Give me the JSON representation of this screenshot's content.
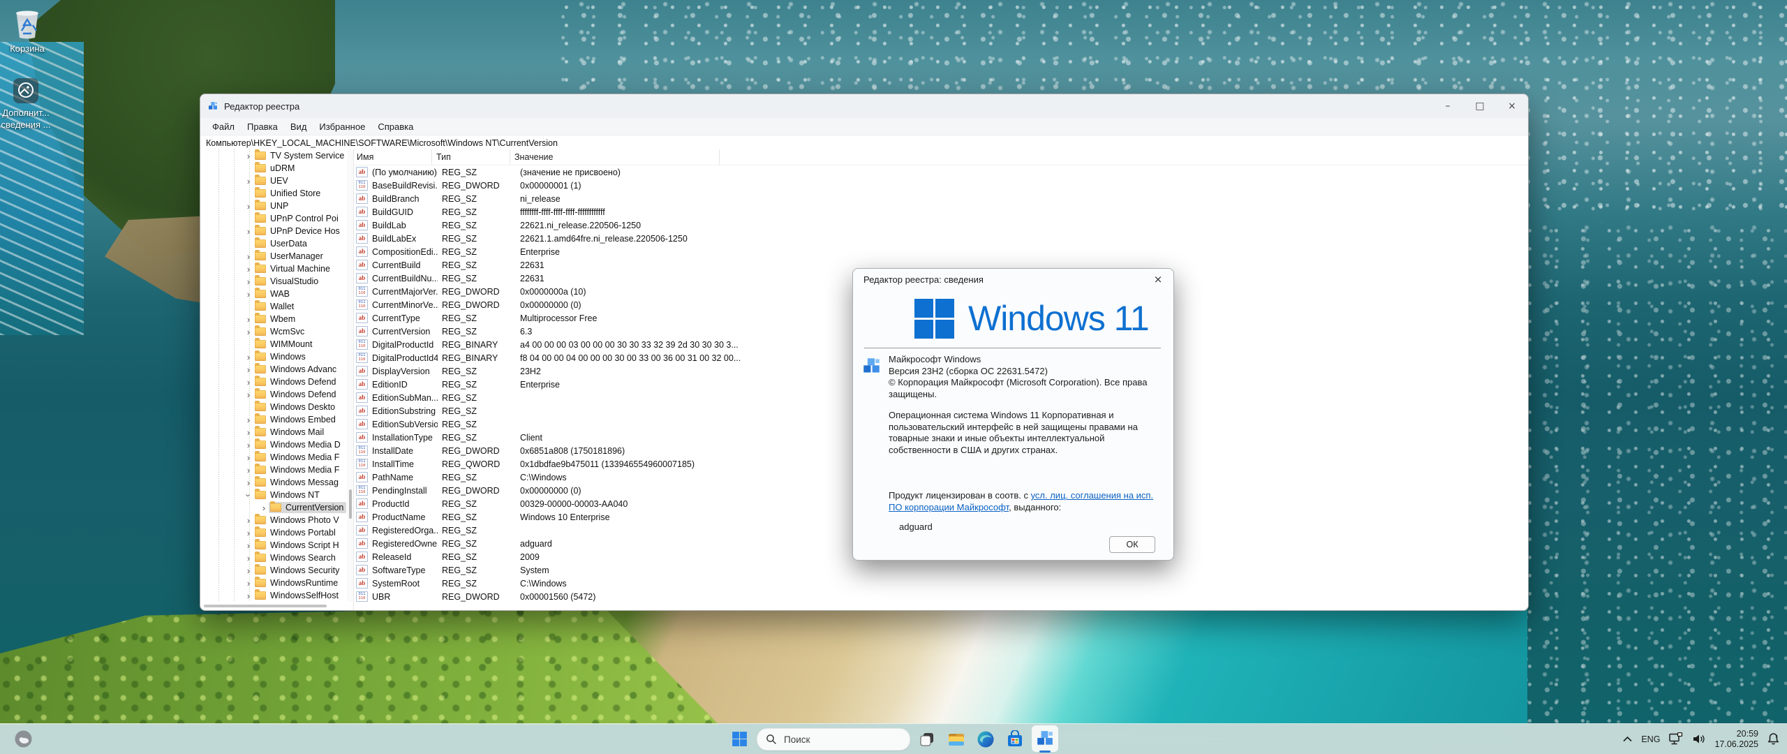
{
  "desktop": {
    "icons": [
      {
        "label": "Корзина"
      },
      {
        "label_line1": "Дополнит...",
        "label_line2": "сведения ..."
      }
    ]
  },
  "registry_window": {
    "title": "Редактор реестра",
    "window_controls": {
      "minimize": "–",
      "maximize": "□",
      "close": "×"
    },
    "menu": [
      "Файл",
      "Правка",
      "Вид",
      "Избранное",
      "Справка"
    ],
    "address": "Компьютер\\HKEY_LOCAL_MACHINE\\SOFTWARE\\Microsoft\\Windows NT\\CurrentVersion",
    "tree": {
      "items": [
        {
          "label": "TV System Service",
          "state": "collapsed",
          "depth": 0,
          "selected": false
        },
        {
          "label": "uDRM",
          "state": "leaf",
          "depth": 0,
          "selected": false
        },
        {
          "label": "UEV",
          "state": "collapsed",
          "depth": 0,
          "selected": false
        },
        {
          "label": "Unified Store",
          "state": "leaf",
          "depth": 0,
          "selected": false
        },
        {
          "label": "UNP",
          "state": "collapsed",
          "depth": 0,
          "selected": false
        },
        {
          "label": "UPnP Control Poi",
          "state": "leaf",
          "depth": 0,
          "selected": false
        },
        {
          "label": "UPnP Device Hos",
          "state": "collapsed",
          "depth": 0,
          "selected": false
        },
        {
          "label": "UserData",
          "state": "leaf",
          "depth": 0,
          "selected": false
        },
        {
          "label": "UserManager",
          "state": "collapsed",
          "depth": 0,
          "selected": false
        },
        {
          "label": "Virtual Machine",
          "state": "collapsed",
          "depth": 0,
          "selected": false
        },
        {
          "label": "VisualStudio",
          "state": "collapsed",
          "depth": 0,
          "selected": false
        },
        {
          "label": "WAB",
          "state": "collapsed",
          "depth": 0,
          "selected": false
        },
        {
          "label": "Wallet",
          "state": "leaf",
          "depth": 0,
          "selected": false
        },
        {
          "label": "Wbem",
          "state": "collapsed",
          "depth": 0,
          "selected": false
        },
        {
          "label": "WcmSvc",
          "state": "collapsed",
          "depth": 0,
          "selected": false
        },
        {
          "label": "WIMMount",
          "state": "leaf",
          "depth": 0,
          "selected": false
        },
        {
          "label": "Windows",
          "state": "collapsed",
          "depth": 0,
          "selected": false
        },
        {
          "label": "Windows Advanc",
          "state": "collapsed",
          "depth": 0,
          "selected": false
        },
        {
          "label": "Windows Defend",
          "state": "collapsed",
          "depth": 0,
          "selected": false
        },
        {
          "label": "Windows Defend",
          "state": "collapsed",
          "depth": 0,
          "selected": false
        },
        {
          "label": "Windows Deskto",
          "state": "leaf",
          "depth": 0,
          "selected": false
        },
        {
          "label": "Windows Embed",
          "state": "collapsed",
          "depth": 0,
          "selected": false
        },
        {
          "label": "Windows Mail",
          "state": "collapsed",
          "depth": 0,
          "selected": false
        },
        {
          "label": "Windows Media D",
          "state": "collapsed",
          "depth": 0,
          "selected": false
        },
        {
          "label": "Windows Media F",
          "state": "collapsed",
          "depth": 0,
          "selected": false
        },
        {
          "label": "Windows Media F",
          "state": "collapsed",
          "depth": 0,
          "selected": false
        },
        {
          "label": "Windows Messag",
          "state": "collapsed",
          "depth": 0,
          "selected": false
        },
        {
          "label": "Windows NT",
          "state": "expanded",
          "depth": 0,
          "selected": false
        },
        {
          "label": "CurrentVersion",
          "state": "collapsed",
          "depth": 1,
          "selected": true
        },
        {
          "label": "Windows Photo V",
          "state": "collapsed",
          "depth": 0,
          "selected": false
        },
        {
          "label": "Windows Portabl",
          "state": "collapsed",
          "depth": 0,
          "selected": false
        },
        {
          "label": "Windows Script H",
          "state": "collapsed",
          "depth": 0,
          "selected": false
        },
        {
          "label": "Windows Search",
          "state": "collapsed",
          "depth": 0,
          "selected": false
        },
        {
          "label": "Windows Security",
          "state": "collapsed",
          "depth": 0,
          "selected": false
        },
        {
          "label": "WindowsRuntime",
          "state": "collapsed",
          "depth": 0,
          "selected": false
        },
        {
          "label": "WindowsSelfHost",
          "state": "collapsed",
          "depth": 0,
          "selected": false
        }
      ]
    },
    "list": {
      "columns": [
        "Имя",
        "Тип",
        "Значение"
      ],
      "rows": [
        {
          "name": "(По умолчанию)",
          "icon": "string",
          "type": "REG_SZ",
          "value": "(значение не присвоено)"
        },
        {
          "name": "BaseBuildRevisi...",
          "icon": "number",
          "type": "REG_DWORD",
          "value": "0x00000001 (1)"
        },
        {
          "name": "BuildBranch",
          "icon": "string",
          "type": "REG_SZ",
          "value": "ni_release"
        },
        {
          "name": "BuildGUID",
          "icon": "string",
          "type": "REG_SZ",
          "value": "ffffffff-ffff-ffff-ffff-ffffffffffff"
        },
        {
          "name": "BuildLab",
          "icon": "string",
          "type": "REG_SZ",
          "value": "22621.ni_release.220506-1250"
        },
        {
          "name": "BuildLabEx",
          "icon": "string",
          "type": "REG_SZ",
          "value": "22621.1.amd64fre.ni_release.220506-1250"
        },
        {
          "name": "CompositionEdi...",
          "icon": "string",
          "type": "REG_SZ",
          "value": "Enterprise"
        },
        {
          "name": "CurrentBuild",
          "icon": "string",
          "type": "REG_SZ",
          "value": "22631"
        },
        {
          "name": "CurrentBuildNu...",
          "icon": "string",
          "type": "REG_SZ",
          "value": "22631"
        },
        {
          "name": "CurrentMajorVer...",
          "icon": "number",
          "type": "REG_DWORD",
          "value": "0x0000000a (10)"
        },
        {
          "name": "CurrentMinorVe...",
          "icon": "number",
          "type": "REG_DWORD",
          "value": "0x00000000 (0)"
        },
        {
          "name": "CurrentType",
          "icon": "string",
          "type": "REG_SZ",
          "value": "Multiprocessor Free"
        },
        {
          "name": "CurrentVersion",
          "icon": "string",
          "type": "REG_SZ",
          "value": "6.3"
        },
        {
          "name": "DigitalProductId",
          "icon": "number",
          "type": "REG_BINARY",
          "value": "a4 00 00 00 03 00 00 00 30 30 33 32 39 2d 30 30 30 3..."
        },
        {
          "name": "DigitalProductId4",
          "icon": "number",
          "type": "REG_BINARY",
          "value": "f8 04 00 00 04 00 00 00 30 00 33 00 36 00 31 00 32 00..."
        },
        {
          "name": "DisplayVersion",
          "icon": "string",
          "type": "REG_SZ",
          "value": "23H2"
        },
        {
          "name": "EditionID",
          "icon": "string",
          "type": "REG_SZ",
          "value": "Enterprise"
        },
        {
          "name": "EditionSubMan...",
          "icon": "string",
          "type": "REG_SZ",
          "value": ""
        },
        {
          "name": "EditionSubstring",
          "icon": "string",
          "type": "REG_SZ",
          "value": ""
        },
        {
          "name": "EditionSubVersion",
          "icon": "string",
          "type": "REG_SZ",
          "value": ""
        },
        {
          "name": "InstallationType",
          "icon": "string",
          "type": "REG_SZ",
          "value": "Client"
        },
        {
          "name": "InstallDate",
          "icon": "number",
          "type": "REG_DWORD",
          "value": "0x6851a808 (1750181896)"
        },
        {
          "name": "InstallTime",
          "icon": "number",
          "type": "REG_QWORD",
          "value": "0x1dbdfae9b475011 (133946554960007185)"
        },
        {
          "name": "PathName",
          "icon": "string",
          "type": "REG_SZ",
          "value": "C:\\Windows"
        },
        {
          "name": "PendingInstall",
          "icon": "number",
          "type": "REG_DWORD",
          "value": "0x00000000 (0)"
        },
        {
          "name": "ProductId",
          "icon": "string",
          "type": "REG_SZ",
          "value": "00329-00000-00003-AA040"
        },
        {
          "name": "ProductName",
          "icon": "string",
          "type": "REG_SZ",
          "value": "Windows 10 Enterprise"
        },
        {
          "name": "RegisteredOrga...",
          "icon": "string",
          "type": "REG_SZ",
          "value": ""
        },
        {
          "name": "RegisteredOwner",
          "icon": "string",
          "type": "REG_SZ",
          "value": "adguard"
        },
        {
          "name": "ReleaseId",
          "icon": "string",
          "type": "REG_SZ",
          "value": "2009"
        },
        {
          "name": "SoftwareType",
          "icon": "string",
          "type": "REG_SZ",
          "value": "System"
        },
        {
          "name": "SystemRoot",
          "icon": "string",
          "type": "REG_SZ",
          "value": "C:\\Windows"
        },
        {
          "name": "UBR",
          "icon": "number",
          "type": "REG_DWORD",
          "value": "0x00001560 (5472)"
        }
      ]
    }
  },
  "about_dialog": {
    "title": "Редактор реестра: сведения",
    "close": "×",
    "logo_text": "Windows 11",
    "product": "Майкрософт Windows",
    "version_line": "Версия 23H2 (сборка ОС 22631.5472)",
    "copyright_line": "© Корпорация Майкрософт (Microsoft Corporation). Все права защищены.",
    "description": "Операционная система Windows 11 Корпоративная и пользовательский интерфейс в ней защищены правами на товарные знаки и иные объекты интеллектуальной собственности в США и других странах.",
    "license_prefix": "Продукт лицензирован в соотв. с ",
    "license_link": "усл. лиц. соглашения на исп. ПО корпорации Майкрософт",
    "license_suffix": ", выданного:",
    "licensee": "adguard",
    "ok_label": "ОК"
  },
  "taskbar": {
    "search_placeholder": "Поиск",
    "tray": {
      "language": "ENG",
      "time": "20:59",
      "date": "17.06.2025"
    }
  },
  "glyphs": {
    "tree_chevron": "›",
    "reg_sz": "ab",
    "reg_num_top": "011",
    "reg_num_bottom": "110"
  },
  "colors": {
    "accent": "#0e70d1",
    "selection_inactive": "#d9d9d9",
    "folder": "#fcd462"
  }
}
